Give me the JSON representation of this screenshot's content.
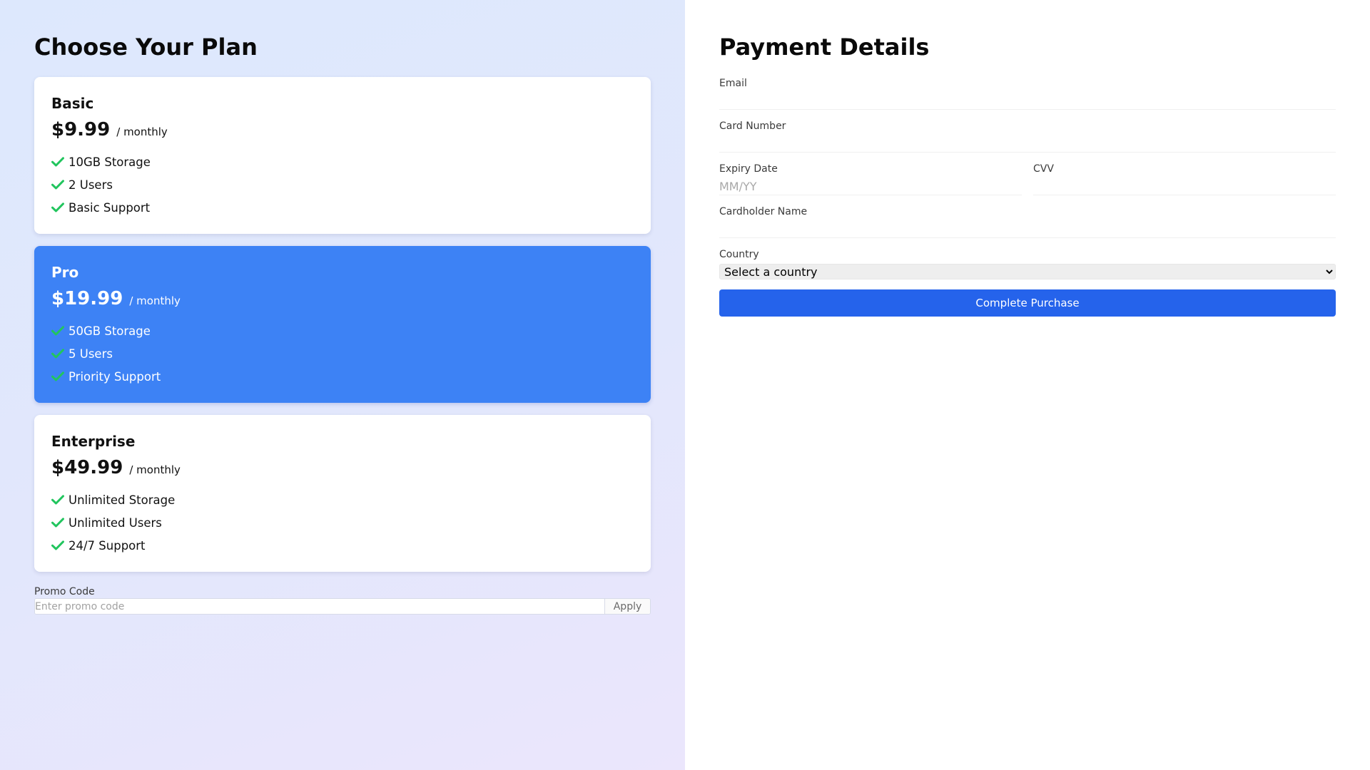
{
  "plans_panel": {
    "title": "Choose Your Plan",
    "plans": [
      {
        "name": "Basic",
        "price": "$9.99",
        "period": "/ monthly",
        "selected": false,
        "features": [
          "10GB Storage",
          "2 Users",
          "Basic Support"
        ]
      },
      {
        "name": "Pro",
        "price": "$19.99",
        "period": "/ monthly",
        "selected": true,
        "features": [
          "50GB Storage",
          "5 Users",
          "Priority Support"
        ]
      },
      {
        "name": "Enterprise",
        "price": "$49.99",
        "period": "/ monthly",
        "selected": false,
        "features": [
          "Unlimited Storage",
          "Unlimited Users",
          "24/7 Support"
        ]
      }
    ],
    "feature_icon": "check-icon",
    "promo": {
      "label": "Promo Code",
      "placeholder": "Enter promo code",
      "value": "",
      "button_label": "Apply"
    }
  },
  "payment_panel": {
    "title": "Payment Details",
    "email": {
      "label": "Email",
      "value": "",
      "placeholder": ""
    },
    "card_number": {
      "label": "Card Number",
      "value": "",
      "placeholder": ""
    },
    "expiry": {
      "label": "Expiry Date",
      "value": "",
      "placeholder": "MM/YY"
    },
    "cvv": {
      "label": "CVV",
      "value": "",
      "placeholder": ""
    },
    "cardholder": {
      "label": "Cardholder Name",
      "value": "",
      "placeholder": ""
    },
    "country": {
      "label": "Country",
      "selected": "Select a country"
    },
    "submit_label": "Complete Purchase"
  },
  "colors": {
    "selected_plan": "#3d82f5",
    "check": "#22c55e",
    "primary_button": "#2563eb",
    "left_bg_start": "#dde8fd",
    "left_bg_end": "#ebe6fc"
  }
}
